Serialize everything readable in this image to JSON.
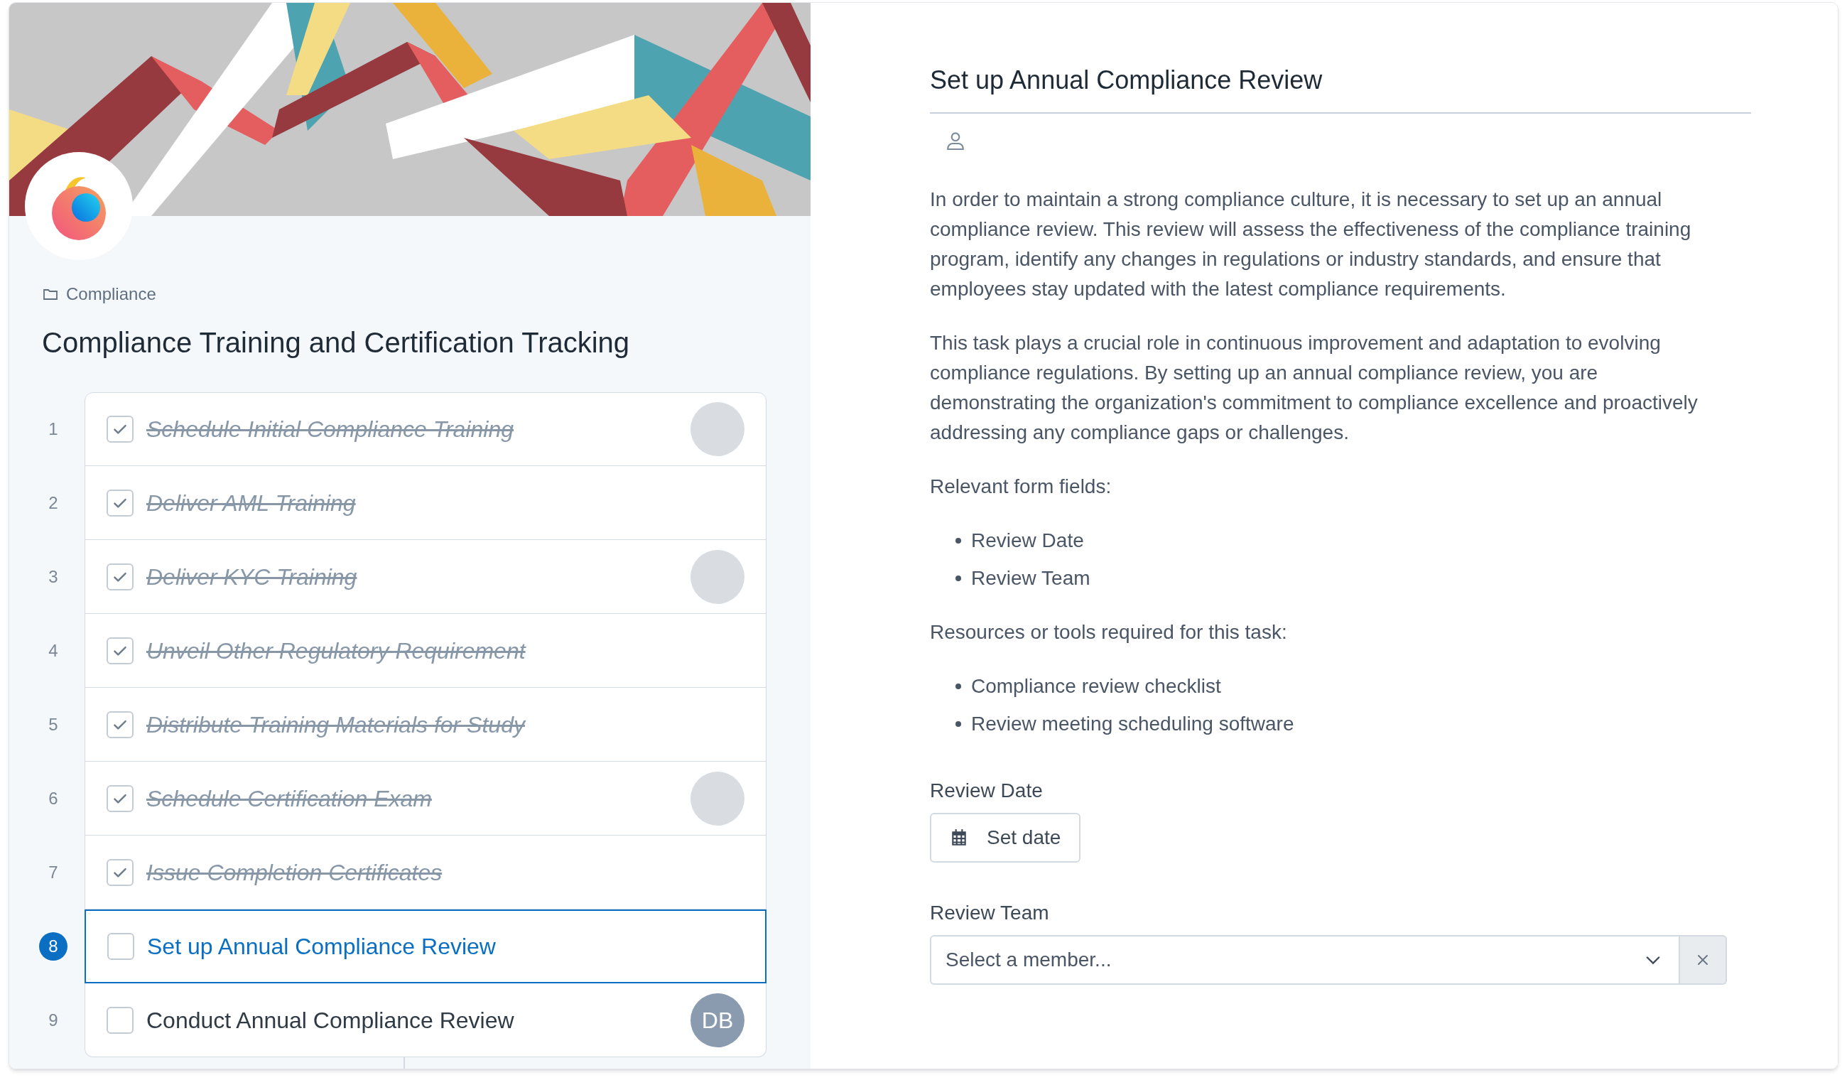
{
  "breadcrumb": {
    "label": "Compliance"
  },
  "checklist_title": "Compliance Training and Certification Tracking",
  "tasks": [
    {
      "number": "1",
      "title": "Schedule Initial Compliance Training",
      "checked": true,
      "selected": false,
      "avatar": {
        "kind": "photo"
      }
    },
    {
      "number": "2",
      "title": "Deliver AML Training",
      "checked": true,
      "selected": false
    },
    {
      "number": "3",
      "title": "Deliver KYC Training",
      "checked": true,
      "selected": false,
      "avatar": {
        "kind": "photo"
      }
    },
    {
      "number": "4",
      "title": "Unveil Other Regulatory Requirement",
      "checked": true,
      "selected": false
    },
    {
      "number": "5",
      "title": "Distribute Training Materials for Study",
      "checked": true,
      "selected": false
    },
    {
      "number": "6",
      "title": "Schedule Certification Exam",
      "checked": true,
      "selected": false,
      "avatar": {
        "kind": "photo"
      }
    },
    {
      "number": "7",
      "title": "Issue Completion Certificates",
      "checked": true,
      "selected": false
    },
    {
      "number": "8",
      "title": "Set up Annual Compliance Review",
      "checked": false,
      "selected": true
    },
    {
      "number": "9",
      "title": "Conduct Annual Compliance Review",
      "checked": false,
      "selected": false,
      "avatar": {
        "kind": "initials",
        "text": "DB"
      }
    }
  ],
  "detail": {
    "title": "Set up Annual Compliance Review",
    "blocks": [
      {
        "kind": "paragraph",
        "text": "In order to maintain a strong compliance culture, it is necessary to set up an annual compliance review. This review will assess the effectiveness of the compliance training program, identify any changes in regulations or industry standards, and ensure that employees stay updated with the latest compliance requirements."
      },
      {
        "kind": "paragraph",
        "text": "This task plays a crucial role in continuous improvement and adaptation to evolving compliance regulations. By setting up an annual compliance review, you are demonstrating the organization's commitment to compliance excellence and proactively addressing any compliance gaps or challenges."
      },
      {
        "kind": "paragraph",
        "text": "Relevant form fields:"
      },
      {
        "kind": "list",
        "items": [
          "Review Date",
          "Review Team"
        ]
      },
      {
        "kind": "paragraph",
        "text": "Resources or tools required for this task:"
      },
      {
        "kind": "list",
        "items": [
          "Compliance review checklist",
          "Review meeting scheduling software"
        ]
      }
    ],
    "fields": [
      {
        "kind": "date",
        "label": "Review Date",
        "button": "Set date"
      },
      {
        "kind": "select",
        "label": "Review Team",
        "placeholder": "Select a member..."
      }
    ]
  }
}
